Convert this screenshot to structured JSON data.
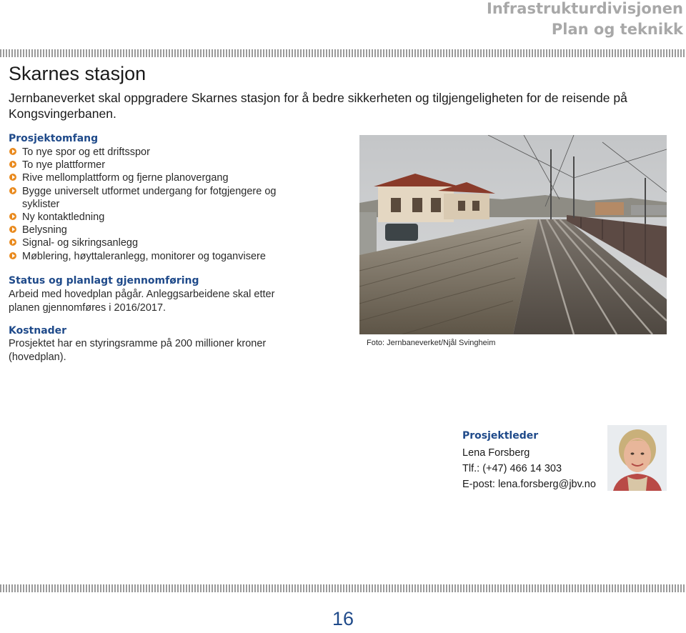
{
  "header": {
    "division": "Infrastrukturdivisjonen",
    "section": "Plan og teknikk"
  },
  "page": {
    "title": "Skarnes stasjon",
    "intro": "Jernbaneverket skal oppgradere Skarnes stasjon for å bedre sikkerheten og tilgjengeligheten for de reisende på Kongsvingerbanen.",
    "number": "16"
  },
  "scope": {
    "heading": "Prosjektomfang",
    "items": [
      "To nye spor og ett driftsspor",
      "To nye plattformer",
      "Rive mellomplattform og fjerne planovergang",
      "Bygge universelt utformet undergang for fotgjengere og syklister",
      "Ny kontaktledning",
      "Belysning",
      "Signal- og sikringsanlegg",
      "Møblering, høyttaleranlegg, monitorer og toganvisere"
    ]
  },
  "status": {
    "heading": "Status og planlagt gjennomføring",
    "text": "Arbeid med hovedplan pågår. Anleggsarbeidene skal etter planen gjennomføres i 2016/2017."
  },
  "costs": {
    "heading": "Kostnader",
    "text": "Prosjektet har en styringsramme på 200 millioner kroner (hovedplan)."
  },
  "photo": {
    "caption": "Foto: Jernbaneverket/Njål Svingheim"
  },
  "leader": {
    "heading": "Prosjektleder",
    "name": "Lena Forsberg",
    "phone": "Tlf.: (+47) 466 14 303",
    "email": "E-post: lena.forsberg@jbv.no"
  },
  "colors": {
    "heading_blue": "#1f4a8a",
    "bullet_orange": "#e98a1e",
    "header_gray": "#a8a8a8"
  }
}
